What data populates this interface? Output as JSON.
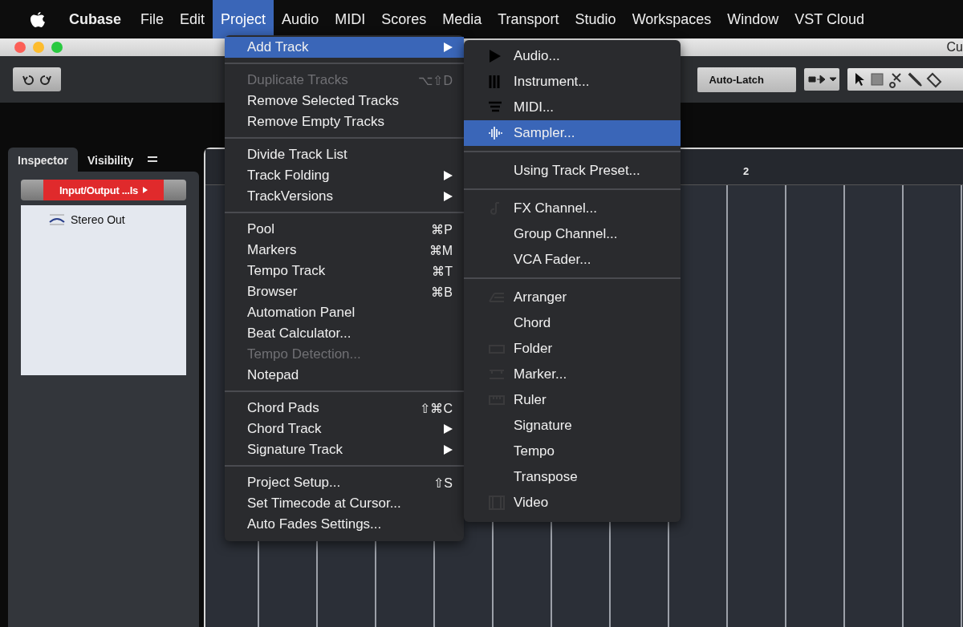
{
  "menubar": {
    "items": [
      {
        "label": "Cubase",
        "kind": "app",
        "selected": false
      },
      {
        "label": "File",
        "kind": "menu",
        "selected": false
      },
      {
        "label": "Edit",
        "kind": "menu",
        "selected": false
      },
      {
        "label": "Project",
        "kind": "menu",
        "selected": true
      },
      {
        "label": "Audio",
        "kind": "menu",
        "selected": false
      },
      {
        "label": "MIDI",
        "kind": "menu",
        "selected": false
      },
      {
        "label": "Scores",
        "kind": "menu",
        "selected": false
      },
      {
        "label": "Media",
        "kind": "menu",
        "selected": false
      },
      {
        "label": "Transport",
        "kind": "menu",
        "selected": false
      },
      {
        "label": "Studio",
        "kind": "menu",
        "selected": false
      },
      {
        "label": "Workspaces",
        "kind": "menu",
        "selected": false
      },
      {
        "label": "Window",
        "kind": "menu",
        "selected": false
      },
      {
        "label": "VST Cloud",
        "kind": "menu",
        "selected": false
      }
    ]
  },
  "window": {
    "title": "Cu"
  },
  "toolbar": {
    "automation_mode": "Auto-Latch"
  },
  "inspector": {
    "tabs": [
      {
        "label": "Inspector",
        "selected": true
      },
      {
        "label": "Visibility",
        "selected": false
      }
    ],
    "section": "Input/Output ...ls",
    "items": [
      "Stereo Out"
    ]
  },
  "ruler": {
    "marks": [
      "2"
    ]
  },
  "project_menu": {
    "groups": [
      [
        {
          "label": "Add Track",
          "selected": true,
          "disabled": false,
          "submenu": true
        }
      ],
      [
        {
          "label": "Duplicate Tracks",
          "shortcut": "⌥⇧D",
          "selected": false,
          "disabled": true,
          "submenu": false
        },
        {
          "label": "Remove Selected Tracks",
          "selected": false,
          "disabled": false,
          "submenu": false
        },
        {
          "label": "Remove Empty Tracks",
          "selected": false,
          "disabled": false,
          "submenu": false
        }
      ],
      [
        {
          "label": "Divide Track List",
          "selected": false,
          "disabled": false,
          "submenu": false
        },
        {
          "label": "Track Folding",
          "selected": false,
          "disabled": false,
          "submenu": true
        },
        {
          "label": "TrackVersions",
          "selected": false,
          "disabled": false,
          "submenu": true
        }
      ],
      [
        {
          "label": "Pool",
          "shortcut": "⌘P",
          "selected": false,
          "disabled": false,
          "submenu": false
        },
        {
          "label": "Markers",
          "shortcut": "⌘M",
          "selected": false,
          "disabled": false,
          "submenu": false
        },
        {
          "label": "Tempo Track",
          "shortcut": "⌘T",
          "selected": false,
          "disabled": false,
          "submenu": false
        },
        {
          "label": "Browser",
          "shortcut": "⌘B",
          "selected": false,
          "disabled": false,
          "submenu": false
        },
        {
          "label": "Automation Panel",
          "selected": false,
          "disabled": false,
          "submenu": false
        },
        {
          "label": "Beat Calculator...",
          "selected": false,
          "disabled": false,
          "submenu": false
        },
        {
          "label": "Tempo Detection...",
          "selected": false,
          "disabled": true,
          "submenu": false
        },
        {
          "label": "Notepad",
          "selected": false,
          "disabled": false,
          "submenu": false
        }
      ],
      [
        {
          "label": "Chord Pads",
          "shortcut": "⇧⌘C",
          "selected": false,
          "disabled": false,
          "submenu": false
        },
        {
          "label": "Chord Track",
          "selected": false,
          "disabled": false,
          "submenu": true
        },
        {
          "label": "Signature Track",
          "selected": false,
          "disabled": false,
          "submenu": true
        }
      ],
      [
        {
          "label": "Project Setup...",
          "shortcut": "⇧S",
          "selected": false,
          "disabled": false,
          "submenu": false
        },
        {
          "label": "Set Timecode at Cursor...",
          "selected": false,
          "disabled": false,
          "submenu": false
        },
        {
          "label": "Auto Fades Settings...",
          "selected": false,
          "disabled": false,
          "submenu": false
        }
      ]
    ]
  },
  "add_track_menu": {
    "groups": [
      [
        {
          "label": "Audio...",
          "kind": "audio",
          "selected": false
        },
        {
          "label": "Instrument...",
          "kind": "instrument",
          "selected": false
        },
        {
          "label": "MIDI...",
          "kind": "midi",
          "selected": false
        },
        {
          "label": "Sampler...",
          "kind": "sampler",
          "selected": true
        }
      ],
      [
        {
          "label": "Using Track Preset...",
          "kind": "plain",
          "selected": false
        }
      ],
      [
        {
          "label": "FX Channel...",
          "kind": "fx",
          "selected": false
        },
        {
          "label": "Group Channel...",
          "kind": "plain",
          "selected": false
        },
        {
          "label": "VCA Fader...",
          "kind": "plain",
          "selected": false
        }
      ],
      [
        {
          "label": "Arranger",
          "kind": "arranger",
          "selected": false
        },
        {
          "label": "Chord",
          "kind": "plain",
          "selected": false
        },
        {
          "label": "Folder",
          "kind": "folder",
          "selected": false
        },
        {
          "label": "Marker...",
          "kind": "marker",
          "selected": false
        },
        {
          "label": "Ruler",
          "kind": "ruler",
          "selected": false
        },
        {
          "label": "Signature",
          "kind": "plain",
          "selected": false
        },
        {
          "label": "Tempo",
          "kind": "plain",
          "selected": false
        },
        {
          "label": "Transpose",
          "kind": "plain",
          "selected": false
        },
        {
          "label": "Video",
          "kind": "video",
          "selected": false
        }
      ]
    ]
  }
}
